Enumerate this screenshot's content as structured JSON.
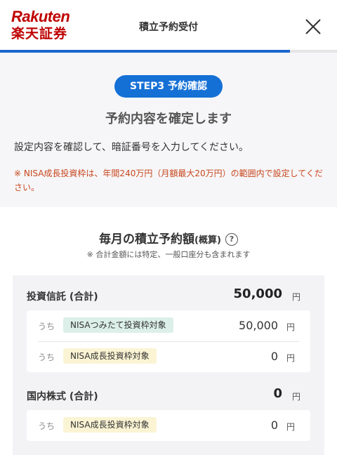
{
  "header": {
    "logo_top": "Rakuten",
    "logo_bottom": "楽天証券",
    "title": "積立予約受付",
    "progress_fraction": 0.86
  },
  "confirm": {
    "step_badge": "STEP3 予約確認",
    "title": "予約内容を確定します",
    "instruction": "設定内容を確認して、暗証番号を入力してください。",
    "note": "※ NISA成長投資枠は、年間240万円（月額最大20万円）の範囲内で設定してください。"
  },
  "summary": {
    "title": "毎月の積立予約額",
    "title_suffix": "(概算)",
    "help_glyph": "?",
    "note": "※ 合計金額には特定、一般口座分も含まれます"
  },
  "sections": [
    {
      "label": "投資信託 (合計)",
      "amount": "50,000",
      "unit": "円",
      "rows": [
        {
          "prefix": "うち",
          "tag": "NISAつみたて投資枠対象",
          "amount": "50,000",
          "unit": "円"
        },
        {
          "prefix": "うち",
          "tag": "NISA成長投資枠対象",
          "amount": "0",
          "unit": "円"
        }
      ]
    },
    {
      "label": "国内株式 (合計)",
      "amount": "0",
      "unit": "円",
      "rows": [
        {
          "prefix": "うち",
          "tag": "NISA成長投資枠対象",
          "amount": "0",
          "unit": "円"
        }
      ]
    }
  ],
  "colors": {
    "brand_red": "#bf0000",
    "accent_blue": "#1570d6",
    "warning_orange": "#c8461d",
    "tag_green": "#dcefe9",
    "tag_yellow": "#fbf4d4"
  },
  "icons": {
    "close": "close-icon",
    "help": "help-icon"
  }
}
